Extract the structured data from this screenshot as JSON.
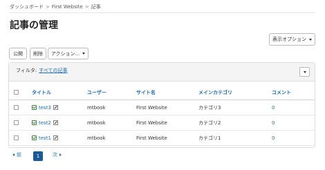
{
  "breadcrumb": {
    "items": [
      "ダッシュボード",
      "First Website",
      "記事"
    ],
    "separator": ">"
  },
  "page": {
    "title": "記事の管理"
  },
  "toolbar": {
    "display_options_label": "表示オプション",
    "publish_label": "公開",
    "delete_label": "削除",
    "actions_label": "アクション..."
  },
  "filter": {
    "label": "フィルタ:",
    "link": "すべての記事"
  },
  "table": {
    "headers": {
      "title": "タイトル",
      "user": "ユーザー",
      "site": "サイト名",
      "category": "メインカテゴリ",
      "comments": "コメント"
    },
    "rows": [
      {
        "title": "test3",
        "user": "mtbook",
        "site": "First Website",
        "category": "カテゴリ3",
        "comments": "0"
      },
      {
        "title": "test2",
        "user": "mtbook",
        "site": "First Website",
        "category": "カテゴリ2",
        "comments": "0"
      },
      {
        "title": "test1",
        "user": "mtbook",
        "site": "First Website",
        "category": "カテゴリ1",
        "comments": "0"
      }
    ]
  },
  "pager": {
    "prev": "前",
    "current": "1",
    "next": "次"
  },
  "colors": {
    "link": "#1a6bb5",
    "current_page": "#1a5a96",
    "published": "#3a8a3a"
  }
}
